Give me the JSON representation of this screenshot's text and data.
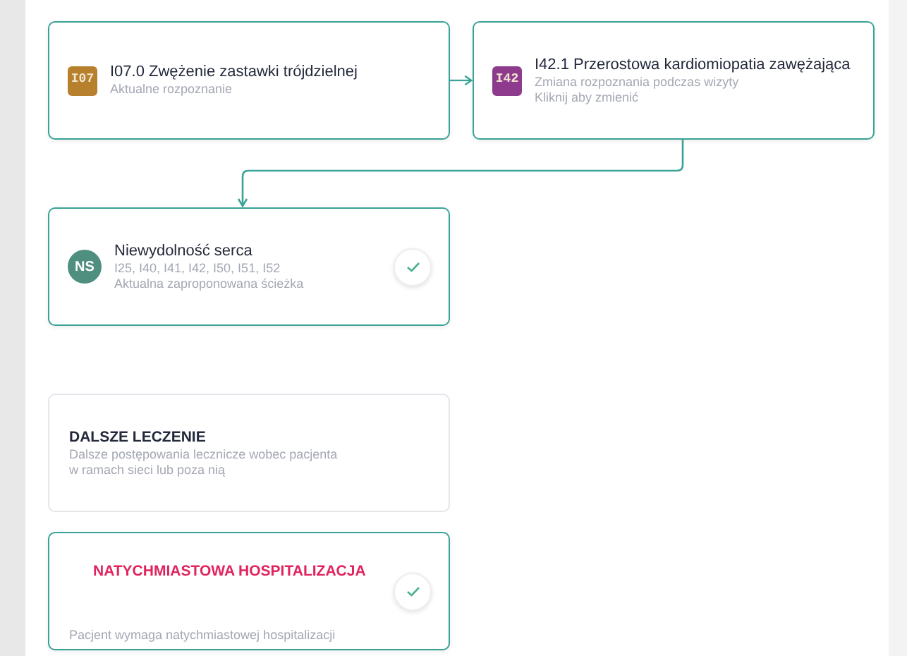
{
  "path": [
    {
      "kind": "code",
      "badge": "I07",
      "color": "#b7802c",
      "title": "I07.0 Zwężenie zastawki trójdzielnej",
      "lines": [
        "Aktualne rozpoznanie"
      ],
      "selected": true,
      "checked": false
    },
    {
      "kind": "code",
      "badge": "I42",
      "color": "#8e3b8e",
      "title": "I42.1 Przerostowa kardiomiopatia zawężająca",
      "lines": [
        "Zmiana rozpoznania podczas wizyty",
        "Kliknij aby zmienić"
      ],
      "selected": true,
      "checked": false
    },
    {
      "kind": "avatar",
      "badge": "NS",
      "color": "#4f8f80",
      "title": "Niewydolność serca",
      "lines": [
        "I25, I40, I41, I42, I50, I51, I52",
        "Aktualna zaproponowana ścieżka"
      ],
      "selected": true,
      "checked": true
    }
  ],
  "options": [
    {
      "title": "DALSZE LECZENIE",
      "lines": [
        "Dalsze postępowania lecznicze wobec pacjenta",
        "w ramach sieci lub poza nią"
      ],
      "selected": false,
      "checked": false,
      "alert": false
    },
    {
      "title": "NATYCHMIASTOWA HOSPITALIZACJA",
      "lines": [
        "Pacjent wymaga natychmiastowej hospitalizacji"
      ],
      "selected": true,
      "checked": true,
      "alert": true
    }
  ]
}
